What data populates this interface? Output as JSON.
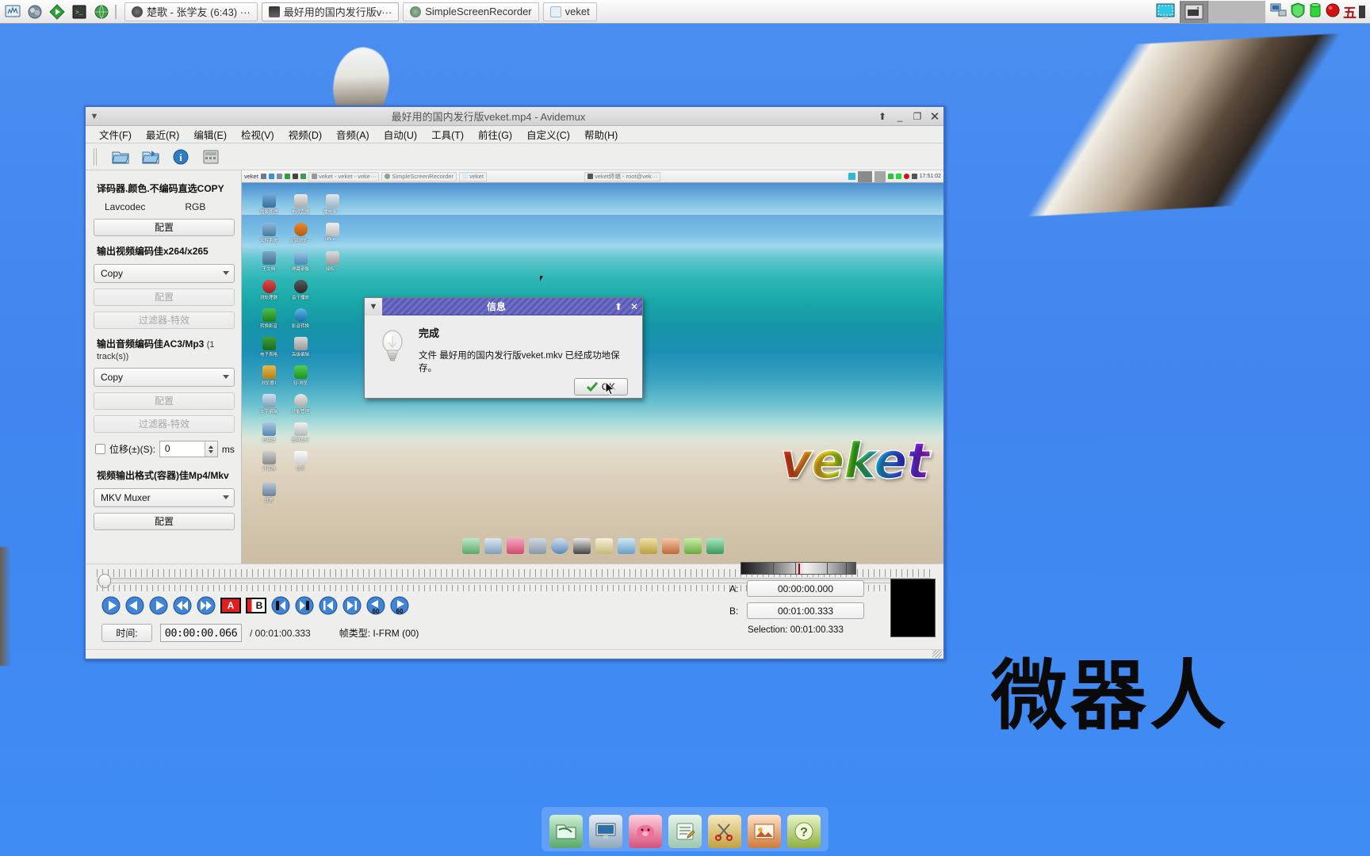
{
  "taskbar": {
    "launcher_icons": [
      "monitor-chart-icon",
      "globe-people-icon",
      "play-diamond-icon",
      "terminal-icon",
      "world-icon"
    ],
    "tasks": [
      {
        "label": "楚歌 - 张学友 (6:43) ···",
        "icon": "audio-player-icon",
        "active": false
      },
      {
        "label": "最好用的国内发行版v···",
        "icon": "video-clapper-icon",
        "active": true
      },
      {
        "label": "SimpleScreenRecorder",
        "icon": "recorder-icon",
        "active": false
      },
      {
        "label": "veket",
        "icon": "file-manager-icon",
        "active": false
      }
    ],
    "tray_icons": [
      "network-computer-icon",
      "shield-green-icon",
      "battery-green-icon",
      "power-red-icon"
    ],
    "tray_text": "五"
  },
  "desktop": {
    "watermark_text": "微器人"
  },
  "avidemux": {
    "title": "最好用的国内发行版veket.mp4 - Avidemux",
    "titlebar_buttons": [
      "shade-icon",
      "pin-icon",
      "minimize-icon",
      "maximize-icon",
      "close-icon"
    ],
    "menu": [
      {
        "label": "文件(F)",
        "name": "menu-file"
      },
      {
        "label": "最近(R)",
        "name": "menu-recent"
      },
      {
        "label": "编辑(E)",
        "name": "menu-edit"
      },
      {
        "label": "检视(V)",
        "name": "menu-view"
      },
      {
        "label": "视频(D)",
        "name": "menu-video"
      },
      {
        "label": "音频(A)",
        "name": "menu-audio"
      },
      {
        "label": "自动(U)",
        "name": "menu-auto"
      },
      {
        "label": "工具(T)",
        "name": "menu-tools"
      },
      {
        "label": "前往(G)",
        "name": "menu-goto"
      },
      {
        "label": "自定义(C)",
        "name": "menu-custom"
      },
      {
        "label": "帮助(H)",
        "name": "menu-help"
      }
    ],
    "toolbar_icons": [
      "open-file-icon",
      "save-file-icon",
      "info-icon",
      "calculator-icon"
    ],
    "left_panel": {
      "decoder_title": "译码器.颜色.不编码直选COPY",
      "decoder_name": "Lavcodec",
      "decoder_color": "RGB",
      "decoder_config_label": "配置",
      "video_title": "输出视频编码佳x264/x265",
      "video_codec": "Copy",
      "video_config_label": "配置",
      "video_filter_label": "过滤器-特效",
      "audio_title": "输出音频编码佳AC3/Mp3",
      "audio_title_suffix": "(1 track(s))",
      "audio_codec": "Copy",
      "audio_config_label": "配置",
      "audio_filter_label": "过滤器-特效",
      "shift_label": "位移(±)(S):",
      "shift_value": "0",
      "shift_unit": "ms",
      "container_title": "视频输出格式(容器)佳Mp4/Mkv",
      "container_value": "MKV Muxer",
      "container_config_label": "配置"
    },
    "preview": {
      "nested_taskbar_label": "veket",
      "nested_tasks": [
        "veket - veket - veke···",
        "SimpleScreenRecorder",
        "veket",
        "veket终端 - root@vek···"
      ],
      "nested_clock": "17:51:02",
      "nested_logo": "veket",
      "nested_desktop_icons": [
        "图像处理",
        "电视直播",
        "播放多···",
        "文件系统",
        "火狐浏览···",
        "office···",
        "王文档",
        "屏幕录像",
        "授权···",
        "测处理器",
        "音干播放",
        "转换影音",
        "影音转换",
        "电子表格",
        "高级编辑",
        "浏览器1",
        "轻-浏览",
        "文字编辑",
        "功能管理",
        "扫描图",
        "图样设计",
        "计算器",
        "日历",
        "设置"
      ]
    },
    "bottom": {
      "nav_icons": [
        "play-icon",
        "prev-icon",
        "next-icon",
        "prev-keyframe-icon",
        "next-keyframe-icon",
        "marker-a-icon",
        "marker-b-icon",
        "go-start-icon",
        "go-end-icon",
        "prev-black-icon",
        "next-black-icon",
        "back-60-icon",
        "forward-60-icon"
      ],
      "marker_a_label": "A",
      "marker_b_label": "B",
      "time_label": "时间:",
      "time_value": "00:00:00.066",
      "time_total": "/ 00:01:00.333",
      "frame_type_label": "帧类型:",
      "frame_type_value": "I-FRM (00)",
      "a_label": "A:",
      "a_value": "00:00:00.000",
      "b_label": "B:",
      "b_value": "00:01:00.333",
      "selection_text": "Selection: 00:01:00.333"
    }
  },
  "dialog": {
    "title": "信息",
    "icon": "lightbulb-icon",
    "heading": "完成",
    "message": "文件 最好用的国内发行版veket.mkv 已经成功地保存。",
    "ok_label": "OK",
    "ok_icon": "check-arrow-icon",
    "titlebar_buttons": [
      "shade-icon",
      "pin-icon",
      "close-icon"
    ]
  },
  "dock": {
    "icons": [
      "file-manager-icon",
      "computer-icon",
      "pink-pig-icon",
      "text-editor-icon",
      "scissors-icon",
      "photo-app-icon",
      "help-question-icon"
    ]
  },
  "colors": {
    "desktop_blue": "#4186ef",
    "dialog_title": "#5b5bb5",
    "accent_red": "#b00020",
    "window_border": "#3b6fd6"
  }
}
